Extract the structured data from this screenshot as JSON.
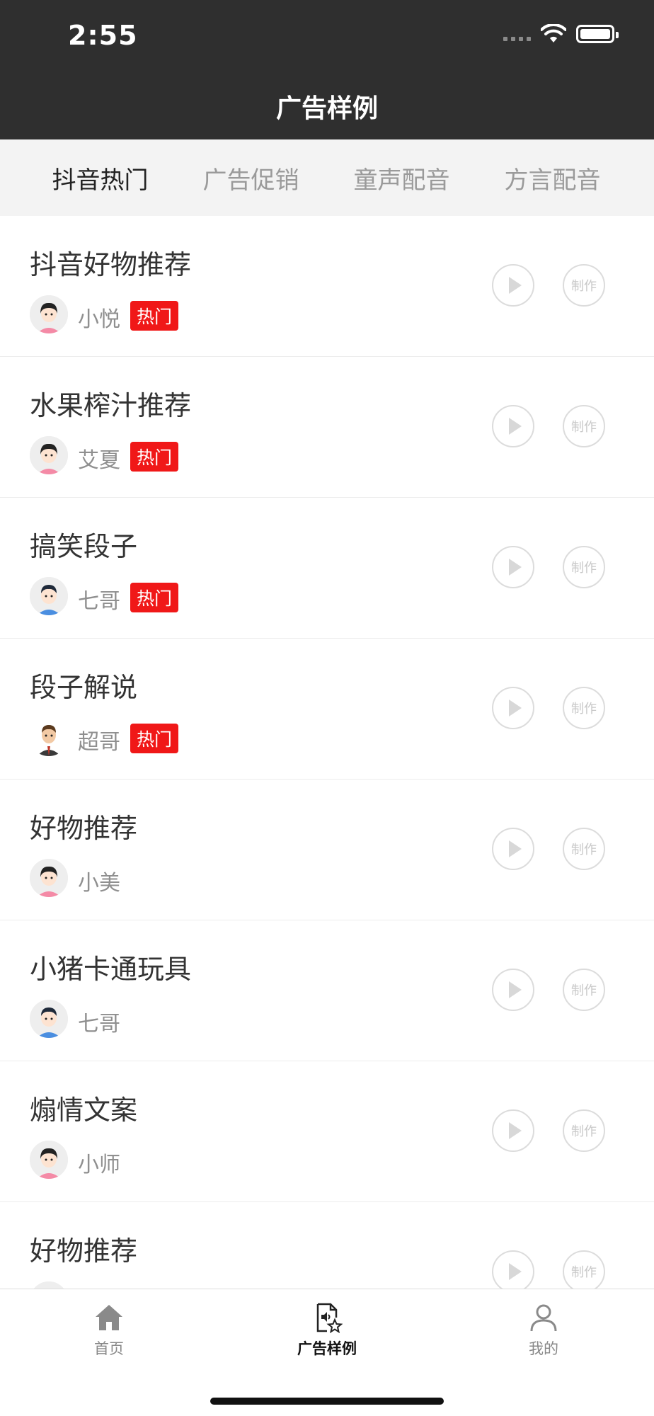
{
  "status": {
    "time": "2:55"
  },
  "nav": {
    "title": "广告样例"
  },
  "tabs": [
    {
      "label": "抖音热门",
      "active": true
    },
    {
      "label": "广告促销",
      "active": false
    },
    {
      "label": "童声配音",
      "active": false
    },
    {
      "label": "方言配音",
      "active": false
    }
  ],
  "list": [
    {
      "title": "抖音好物推荐",
      "speaker": "小悦",
      "hot": "热门",
      "avatar": "female-avatar",
      "make": "制作"
    },
    {
      "title": "水果榨汁推荐",
      "speaker": "艾夏",
      "hot": "热门",
      "avatar": "female-avatar",
      "make": "制作"
    },
    {
      "title": "搞笑段子",
      "speaker": "七哥",
      "hot": "热门",
      "avatar": "male-avatar",
      "make": "制作"
    },
    {
      "title": "段子解说",
      "speaker": "超哥",
      "hot": "热门",
      "avatar": "male-suit-avatar",
      "make": "制作"
    },
    {
      "title": "好物推荐",
      "speaker": "小美",
      "avatar": "female-avatar",
      "make": "制作"
    },
    {
      "title": "小猪卡通玩具",
      "speaker": "七哥",
      "avatar": "male-avatar",
      "make": "制作"
    },
    {
      "title": "煽情文案",
      "speaker": "小师",
      "avatar": "female-avatar",
      "make": "制作"
    },
    {
      "title": "好物推荐",
      "speaker": "",
      "avatar": "female-avatar",
      "make": "制作"
    }
  ],
  "tabbar": [
    {
      "label": "首页",
      "icon": "home-icon"
    },
    {
      "label": "广告样例",
      "icon": "audio-file-star-icon",
      "active": true
    },
    {
      "label": "我的",
      "icon": "user-icon"
    }
  ],
  "colors": {
    "header": "#2f2f2f",
    "hot_badge": "#f01818",
    "tab_active": "#222222",
    "tab_inactive": "#9a9a9a"
  }
}
